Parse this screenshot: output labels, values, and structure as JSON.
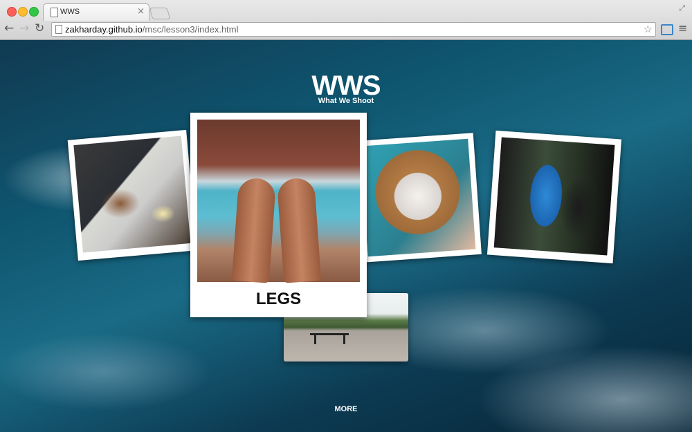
{
  "browser": {
    "tab_title": "WWS",
    "url_host": "zakharday.github.io",
    "url_path": "/msc/lesson3/index.html",
    "icons": [
      "back-icon",
      "forward-icon",
      "reload-icon",
      "page-icon",
      "star-icon",
      "menu-icon",
      "close-icon"
    ]
  },
  "site": {
    "logo": "WWS",
    "tagline": "What We Shoot",
    "photos": [
      {
        "name": "food"
      },
      {
        "name": "legs",
        "caption": "LEGS"
      },
      {
        "name": "cat"
      },
      {
        "name": "mirror"
      },
      {
        "name": "skate"
      }
    ],
    "more_label": "MORE"
  },
  "colors": {
    "accent": "#ffffff",
    "ocean": "#0f5670"
  }
}
